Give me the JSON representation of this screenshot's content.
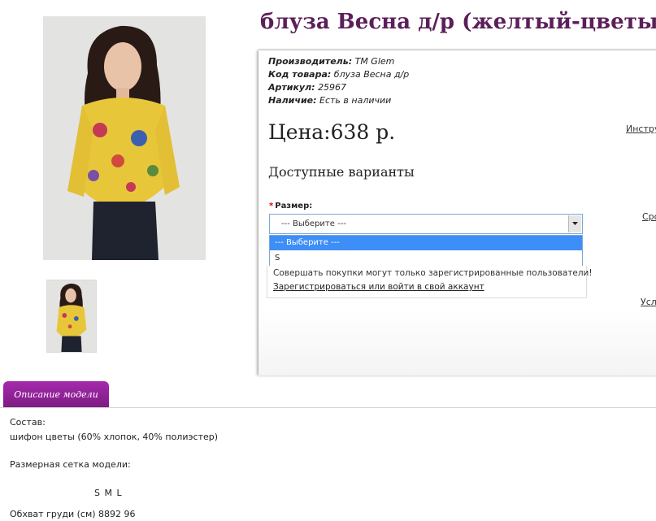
{
  "product": {
    "title": "блуза Весна д/р (желтый-цветы)",
    "meta": [
      {
        "label": "Производитель:",
        "value": "TM Glem"
      },
      {
        "label": "Код товара:",
        "value": "блуза Весна д/р"
      },
      {
        "label": "Артикул:",
        "value": "25967"
      },
      {
        "label": "Наличие:",
        "value": "Есть в наличии"
      }
    ],
    "price": "Цена:638 р.",
    "variants_heading": "Доступные варианты",
    "side_links": [
      "Инстру",
      "Срo",
      "Усл"
    ]
  },
  "options": {
    "size_label": "Размер:",
    "required_mark": "*",
    "select_value": "--- Выберите ---",
    "items": [
      "--- Выберите ---",
      "S"
    ]
  },
  "notice": {
    "text": "Совершать покупки могут только зарегистрированные пользователи!",
    "link": "Зарегистрироваться или войти в свой аккаунт"
  },
  "tabs": {
    "description": "Описание модели"
  },
  "description": {
    "composition_label": "Состав:",
    "composition_value": "шифон цветы (60% хлопок, 40% полиэстер)",
    "size_chart_label": "Размерная сетка модели:",
    "size_headers": "S M L",
    "chest_row": "Обхват груди (см) 8892 96"
  },
  "colors": {
    "title": "#5b1f59",
    "tab": "#8e2296",
    "dropdown_selected": "#3e8ef7",
    "blouse": "#e8c63a"
  }
}
